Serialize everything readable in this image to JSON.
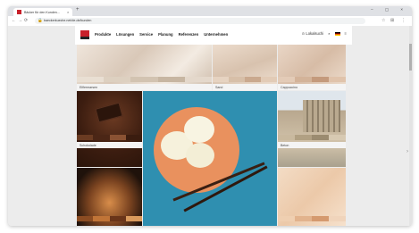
{
  "browser": {
    "tab_title": "Bäcker für den Kunden…",
    "tab_close": "×",
    "new_tab": "+",
    "window_controls": "– ▢ ×",
    "url": "baeckerkueche.net/de-de/kunden",
    "nav": {
      "back": "←",
      "forward": "→",
      "reload": "⟳",
      "home": "⌂"
    },
    "toolbar": {
      "star": "☆",
      "extensions": "⊞",
      "menu": "⋮"
    }
  },
  "site": {
    "menu": [
      "Produkte",
      "Lösungen",
      "Service",
      "Planung",
      "Referenzen",
      "Unternehmen"
    ],
    "header_right": {
      "account": "⊙ Lokalsuchi",
      "search": "⌕",
      "lang": "DE",
      "menu": "≡"
    }
  },
  "tiles": [
    {
      "label": "Eiflermarsen"
    },
    {
      "label": "Sand"
    },
    {
      "label": "Cappuccino"
    },
    {
      "label": "Schokolade"
    },
    {
      "label": ""
    },
    {
      "label": "Beton"
    },
    {
      "label": ""
    },
    {
      "label": ""
    }
  ],
  "colors": {
    "brand": "#c8202a",
    "tile_bg_blue": "#2f8fb0"
  }
}
